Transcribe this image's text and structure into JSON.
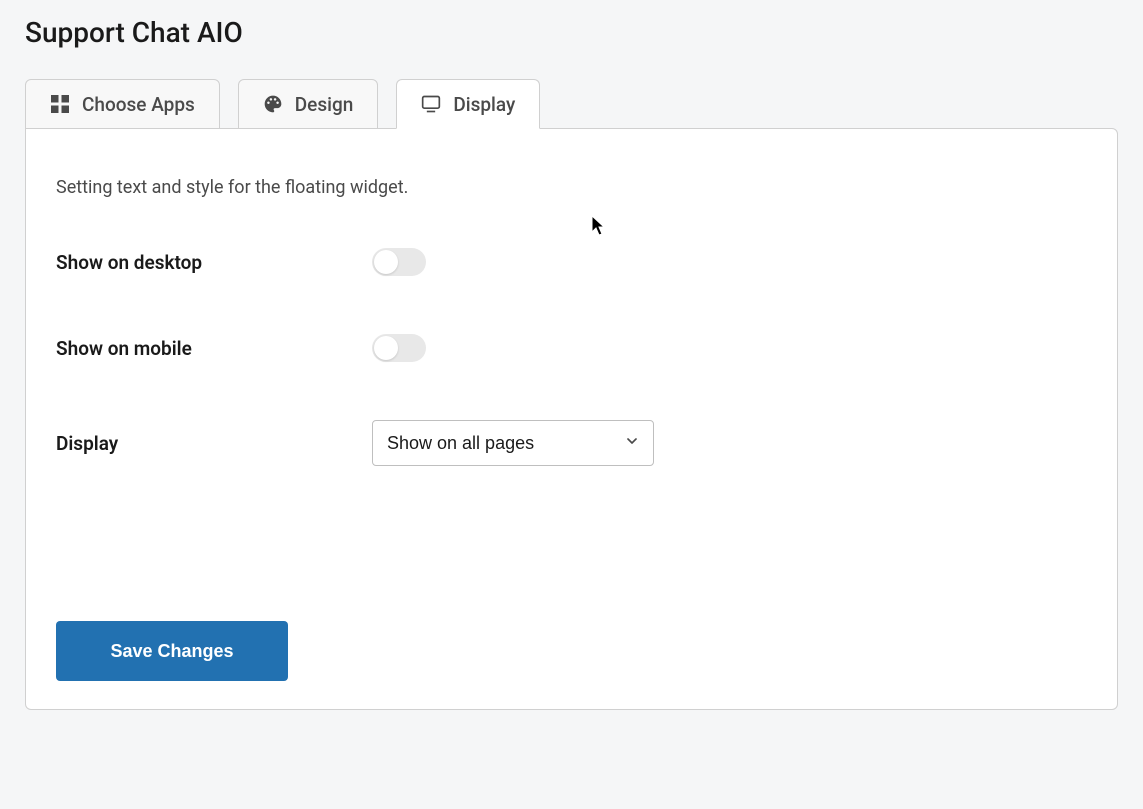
{
  "page": {
    "title": "Support Chat AIO"
  },
  "tabs": [
    {
      "label": "Choose Apps",
      "icon": "grid-icon"
    },
    {
      "label": "Design",
      "icon": "palette-icon"
    },
    {
      "label": "Display",
      "icon": "monitor-icon"
    }
  ],
  "active_tab_index": 2,
  "panel": {
    "description": "Setting text and style for the floating widget.",
    "fields": {
      "show_desktop": {
        "label": "Show on desktop",
        "value": false
      },
      "show_mobile": {
        "label": "Show on mobile",
        "value": false
      },
      "display": {
        "label": "Display",
        "selected": "Show on all pages"
      }
    },
    "save_label": "Save Changes"
  }
}
